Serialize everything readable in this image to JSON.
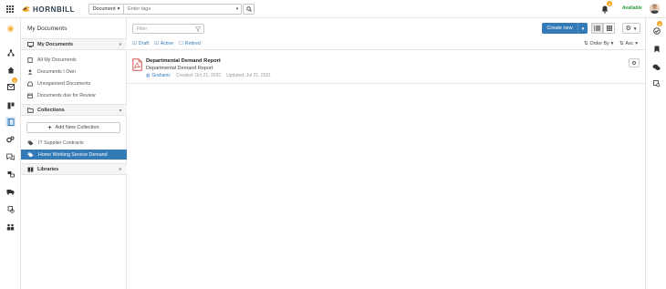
{
  "header": {
    "logo_text": "HORNBILL",
    "search_scope": "Document",
    "search_placeholder": "Enter tags",
    "notification_count": "3",
    "availability": "Available"
  },
  "rail": {
    "mail_badge": "3"
  },
  "right_rail": {
    "activity_badge": "4"
  },
  "sidebar": {
    "title": "My Documents",
    "my_documents": {
      "heading": "My Documents",
      "items": [
        {
          "label": "All My Documents"
        },
        {
          "label": "Documents I Own"
        },
        {
          "label": "Unorganised Documents"
        },
        {
          "label": "Documents due for Review"
        }
      ]
    },
    "collections": {
      "heading": "Collections",
      "add_label": "Add New Collection",
      "items": [
        {
          "label": "IT Supplier Contracts"
        },
        {
          "label": "Home Working Service Demand"
        }
      ]
    },
    "libraries": {
      "heading": "Libraries"
    }
  },
  "main": {
    "filter_placeholder": "Filter",
    "create_label": "Create new",
    "status_filters": [
      {
        "label": "Draft"
      },
      {
        "label": "Active"
      },
      {
        "label": "Retired"
      }
    ],
    "order_by": "Order By",
    "sort_direction": "Asc",
    "documents": [
      {
        "title": "Departmental Demand Report",
        "description": "Departmental Demand Report",
        "owner": "Grahamc",
        "created": "Created: Oct 21, 2020",
        "updated": "Updated: Jul 21, 2021"
      }
    ]
  },
  "colors": {
    "accent": "#337ab7",
    "badge": "#f5a623",
    "available": "#2e9e3e",
    "pdf_red": "#d9534f"
  }
}
